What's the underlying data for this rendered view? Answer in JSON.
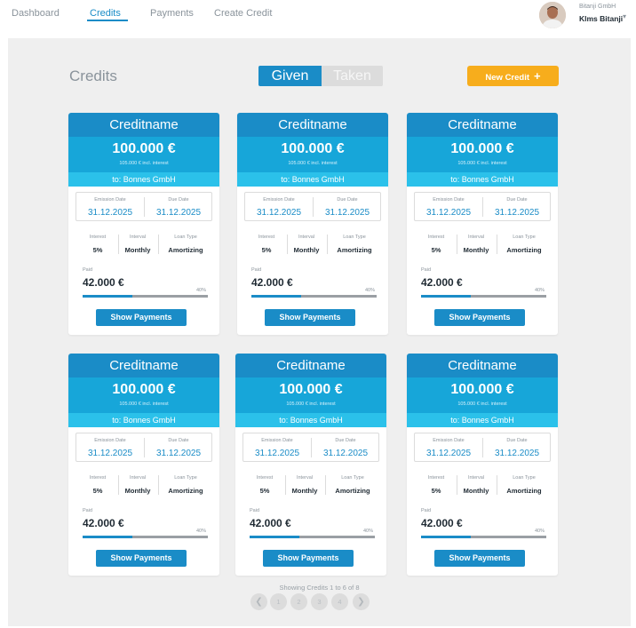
{
  "nav": {
    "links": [
      "Dashboard",
      "Credits",
      "Payments",
      "Create Credit"
    ],
    "active": "Credits"
  },
  "user": {
    "company": "Bitanji GmbH",
    "name": "Klms Bitanji"
  },
  "page": {
    "title": "Credits",
    "toggle": {
      "given": "Given",
      "taken": "Taken",
      "selected": "Given"
    },
    "new_credit_label": "New Credit",
    "new_credit_icon": "plus-icon"
  },
  "labels": {
    "emission_date": "Emission Date",
    "due_date": "Due Date",
    "interest": "Interest",
    "interval": "Interval",
    "loan_type": "Loan Type",
    "paid": "Paid",
    "show_payments": "Show Payments"
  },
  "credits": [
    {
      "name": "Creditname",
      "amount": "100.000 €",
      "incl_interest": "105.000 € incl. interest",
      "to": "to: Bonnes GmbH",
      "emission_date": "31.12.2025",
      "due_date": "31.12.2025",
      "interest": "5%",
      "interval": "Monthly",
      "loan_type": "Amortizing",
      "paid": "42.000 €",
      "paid_percent": "40%",
      "progress": 0.4
    },
    {
      "name": "Creditname",
      "amount": "100.000 €",
      "incl_interest": "105.000 € incl. interest",
      "to": "to: Bonnes GmbH",
      "emission_date": "31.12.2025",
      "due_date": "31.12.2025",
      "interest": "5%",
      "interval": "Monthly",
      "loan_type": "Amortizing",
      "paid": "42.000 €",
      "paid_percent": "40%",
      "progress": 0.4
    },
    {
      "name": "Creditname",
      "amount": "100.000 €",
      "incl_interest": "105.000 € incl. interest",
      "to": "to: Bonnes GmbH",
      "emission_date": "31.12.2025",
      "due_date": "31.12.2025",
      "interest": "5%",
      "interval": "Monthly",
      "loan_type": "Amortizing",
      "paid": "42.000 €",
      "paid_percent": "40%",
      "progress": 0.4
    },
    {
      "name": "Creditname",
      "amount": "100.000 €",
      "incl_interest": "105.000 € incl. interest",
      "to": "to: Bonnes GmbH",
      "emission_date": "31.12.2025",
      "due_date": "31.12.2025",
      "interest": "5%",
      "interval": "Monthly",
      "loan_type": "Amortizing",
      "paid": "42.000 €",
      "paid_percent": "40%",
      "progress": 0.4
    },
    {
      "name": "Creditname",
      "amount": "100.000 €",
      "incl_interest": "105.000 € incl. interest",
      "to": "to: Bonnes GmbH",
      "emission_date": "31.12.2025",
      "due_date": "31.12.2025",
      "interest": "5%",
      "interval": "Monthly",
      "loan_type": "Amortizing",
      "paid": "42.000 €",
      "paid_percent": "40%",
      "progress": 0.4
    },
    {
      "name": "Creditname",
      "amount": "100.000 €",
      "incl_interest": "105.000 € incl. interest",
      "to": "to: Bonnes GmbH",
      "emission_date": "31.12.2025",
      "due_date": "31.12.2025",
      "interest": "5%",
      "interval": "Monthly",
      "loan_type": "Amortizing",
      "paid": "42.000 €",
      "paid_percent": "40%",
      "progress": 0.4
    }
  ],
  "pagination": {
    "summary": "Showing Credits 1 to 6 of 8",
    "pages": [
      "1",
      "2",
      "3",
      "4"
    ],
    "prev_icon": "chevron-left-icon",
    "next_icon": "chevron-right-icon"
  },
  "colors": {
    "primary": "#1a8cc7",
    "amount_band": "#17a6d9",
    "recipient_band": "#2bc1ea",
    "accent": "#f7ad1c",
    "background": "#efefef"
  }
}
